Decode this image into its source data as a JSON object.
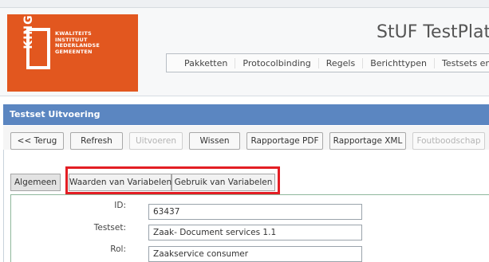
{
  "logo": {
    "mark": "KING",
    "line1": "KWALITEITS",
    "line2": "INSTITUUT",
    "line3": "NEDERLANDSE",
    "line4": "GEMEENTEN",
    "color": "#e2571f"
  },
  "header": {
    "title": "StUF TestPlatfo",
    "nav": [
      "Pakketten",
      "Protocolbinding",
      "Regels",
      "Berichttypen",
      "Testsets en sce"
    ]
  },
  "panel": {
    "title": "Testset Uitvoering",
    "color": "#5b86c1"
  },
  "toolbar": {
    "back": "<< Terug",
    "refresh": "Refresh",
    "run": "Uitvoeren",
    "clear": "Wissen",
    "report_pdf": "Rapportage PDF",
    "report_xml": "Rapportage XML",
    "error_message": "Foutboodschap"
  },
  "tabs": {
    "general": "Algemeen",
    "variable_values": "Waarden van Variabelen",
    "variable_usage": "Gebruik van Variabelen",
    "highlight_color": "#e31e24"
  },
  "form": {
    "id_label": "ID:",
    "id_value": "63437",
    "testset_label": "Testset:",
    "testset_value": "Zaak- Document services 1.1",
    "role_label": "Rol:",
    "role_value": "Zaakservice consumer"
  }
}
